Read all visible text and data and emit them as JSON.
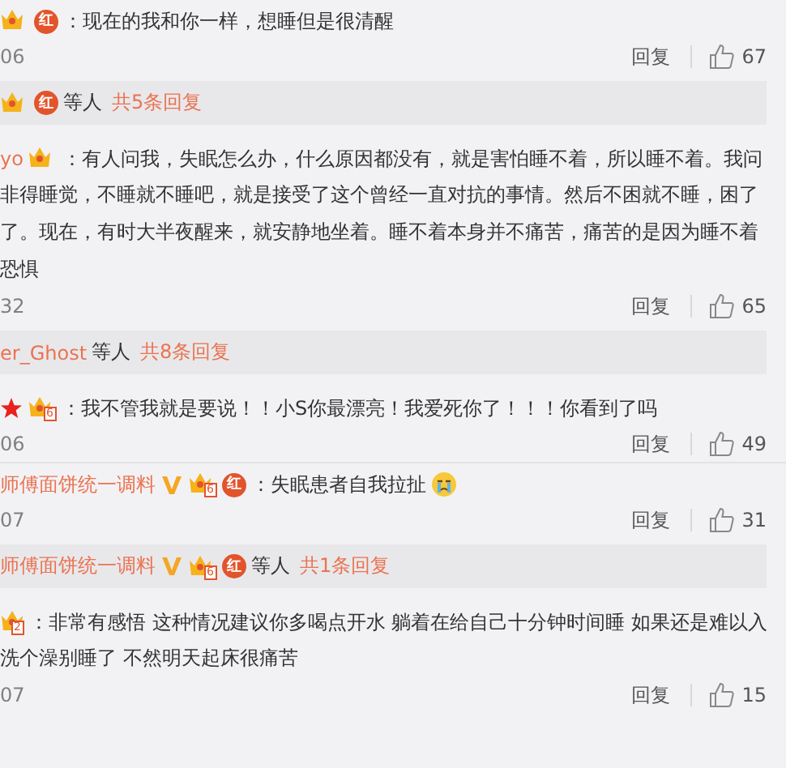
{
  "comments": [
    {
      "badges": [
        {
          "kind": "crown"
        },
        {
          "kind": "hong",
          "label": "红"
        }
      ],
      "lines": [
        "：现在的我和你一样，想睡但是很清醒"
      ],
      "time": "06",
      "reply_label": "回复",
      "likes": "67",
      "replies": {
        "badges": [
          {
            "kind": "crown"
          },
          {
            "kind": "hong",
            "label": "红"
          }
        ],
        "suffix": "等人",
        "count": "共5条回复"
      }
    },
    {
      "author": "yo",
      "badges": [
        {
          "kind": "crown"
        }
      ],
      "lines": [
        "：有人问我，失眠怎么办，什么原因都没有，就是害怕睡不着，所以睡不着。我问",
        "非得睡觉，不睡就不睡吧，就是接受了这个曾经一直对抗的事情。然后不困就不睡，困了",
        "了。现在，有时大半夜醒来，就安静地坐着。睡不着本身并不痛苦，痛苦的是因为睡不着",
        "恐惧"
      ],
      "time": "32",
      "reply_label": "回复",
      "likes": "65",
      "replies": {
        "names": "er_Ghost",
        "suffix": "等人",
        "count": "共8条回复"
      }
    },
    {
      "badges": [
        {
          "kind": "star"
        },
        {
          "kind": "crown",
          "label": "6"
        }
      ],
      "lines": [
        "：我不管我就是要说！！小S你最漂亮！我爱死你了！！！你看到了吗"
      ],
      "time": "06",
      "reply_label": "回复",
      "likes": "49"
    },
    {
      "author": "师傅面饼统一调料",
      "badges": [
        {
          "kind": "v"
        },
        {
          "kind": "crown",
          "label": "6"
        },
        {
          "kind": "hong",
          "label": "红"
        }
      ],
      "lines": [
        "：失眠患者自我拉扯"
      ],
      "emoji": true,
      "time": "07",
      "reply_label": "回复",
      "likes": "31",
      "replies": {
        "names": "师傅面饼统一调料",
        "badges": [
          {
            "kind": "v"
          },
          {
            "kind": "crown",
            "label": "6"
          },
          {
            "kind": "hong",
            "label": "红"
          }
        ],
        "suffix": "等人",
        "count": "共1条回复"
      }
    },
    {
      "badges": [
        {
          "kind": "crown",
          "label": "2"
        }
      ],
      "lines": [
        "：非常有感悟 这种情况建议你多喝点开水 躺着在给自己十分钟时间睡 如果还是难以入",
        "洗个澡别睡了 不然明天起床很痛苦"
      ],
      "time": "07",
      "reply_label": "回复",
      "likes": "15"
    }
  ]
}
